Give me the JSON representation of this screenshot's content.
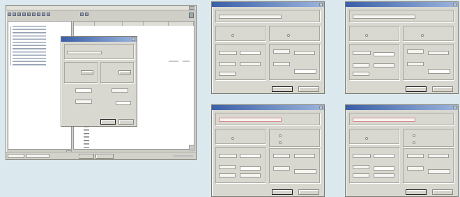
{
  "main_window": {
    "list_headers": [
      "",
      "",
      "",
      "",
      ""
    ],
    "tree_items": [
      "",
      "",
      "",
      "",
      "",
      "",
      "",
      "",
      "",
      "",
      "",
      ""
    ],
    "status_cells": [
      "",
      ""
    ]
  },
  "dialog": {
    "ok_label": "",
    "cancel_label": ""
  }
}
